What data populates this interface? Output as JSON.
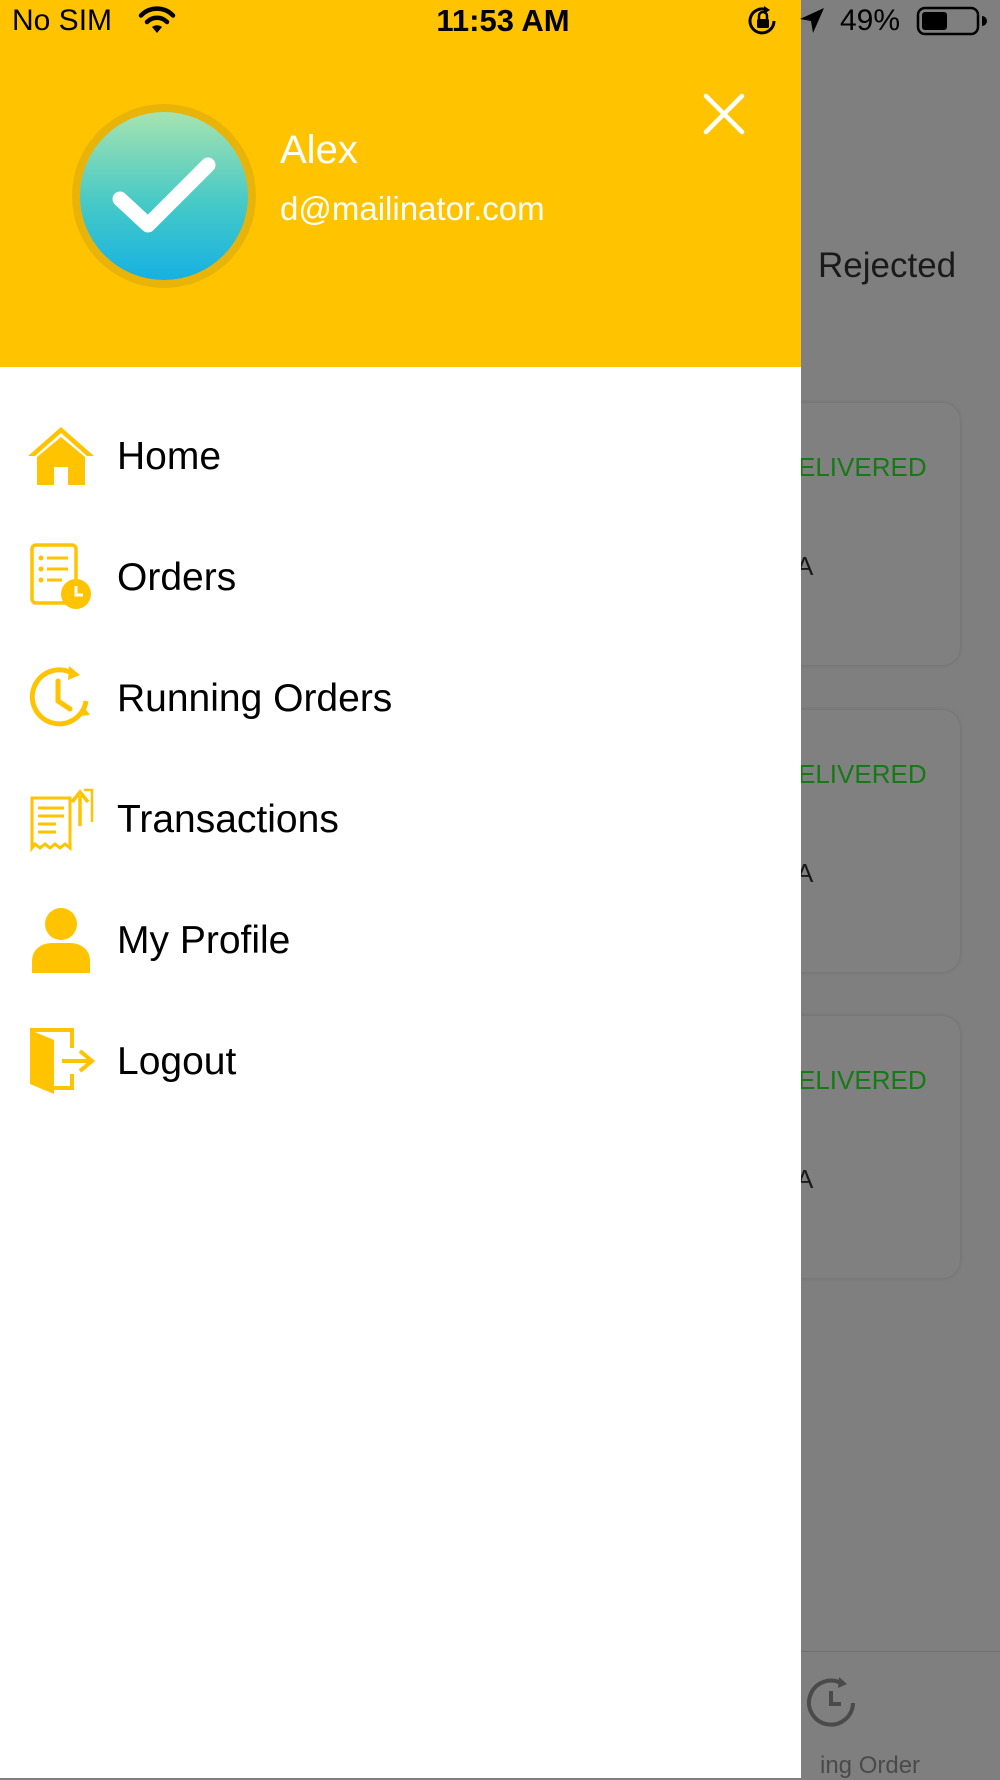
{
  "status_bar": {
    "carrier": "No SIM",
    "time": "11:53 AM",
    "battery": "49%",
    "battery_level": 0.49
  },
  "drawer": {
    "user": {
      "name": "Alex",
      "email": "d@mailinator.com"
    },
    "menu": [
      {
        "label": "Home",
        "icon": "home-icon"
      },
      {
        "label": "Orders",
        "icon": "orders-icon"
      },
      {
        "label": "Running Orders",
        "icon": "clock-icon"
      },
      {
        "label": "Transactions",
        "icon": "receipt-icon"
      },
      {
        "label": "My Profile",
        "icon": "user-icon"
      },
      {
        "label": "Logout",
        "icon": "logout-icon"
      }
    ]
  },
  "background": {
    "tab_label": "Rejected",
    "cards": [
      {
        "status": "ELIVERED",
        "letter": "A"
      },
      {
        "status": "ELIVERED",
        "letter": "A"
      },
      {
        "status": "ELIVERED",
        "letter": "A"
      }
    ],
    "bottom_nav_label": "ing Order"
  },
  "colors": {
    "accent": "#ffc300",
    "overlay": "#7f7f7f",
    "delivered": "#157a15"
  }
}
